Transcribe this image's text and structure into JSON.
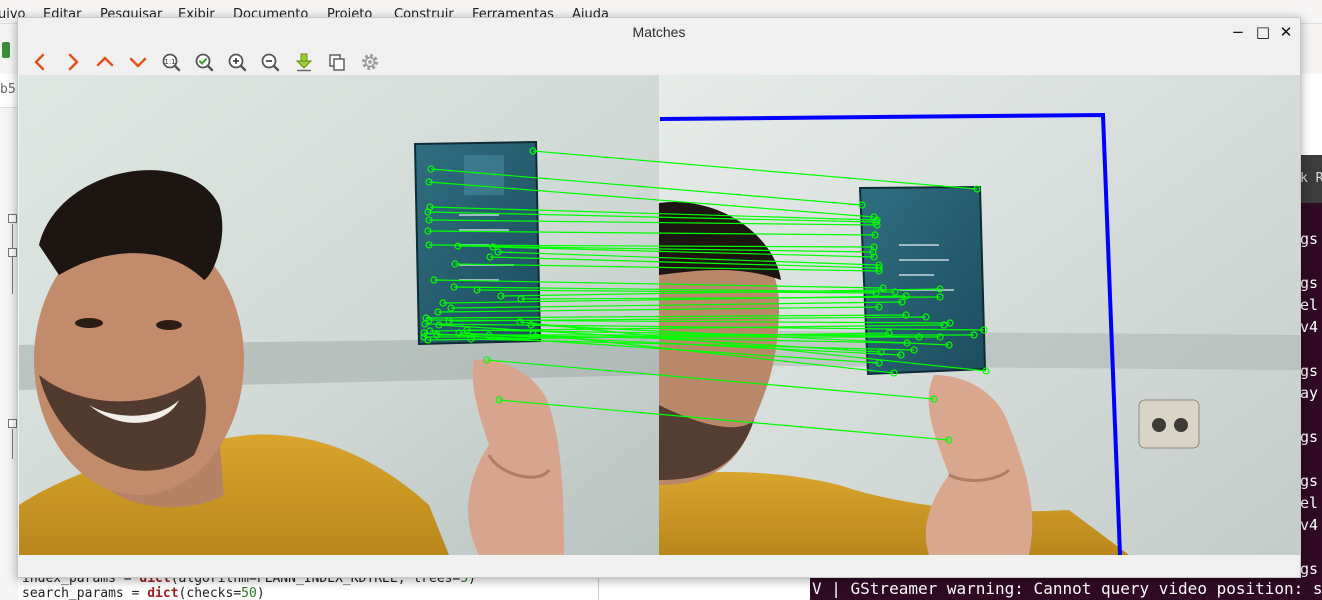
{
  "background_app": {
    "menu": [
      "uivo",
      "Editar",
      "Pesquisar",
      "Exibir",
      "Documento",
      "Projeto",
      "Construir",
      "Ferramentas",
      "Ajuda"
    ],
    "tab_fragment": "b5",
    "code_lines": [
      {
        "plain1": "index_params = ",
        "kw": "dict",
        "plain2": "(algorithm=FLANN_INDEX_KDTREE, trees=",
        "num": "5",
        "plain3": ")"
      },
      {
        "plain1": "search_params = ",
        "kw": "dict",
        "plain2": "(checks=",
        "num": "50",
        "plain3": ")"
      }
    ]
  },
  "terminal": {
    "tab_fragment": "k R",
    "lines": [
      "gs",
      "gs",
      "el",
      "v4",
      "gs",
      "ay",
      "gs",
      "gs",
      "el",
      "v4",
      "gs"
    ],
    "bottom_line": "V | GStreamer warning: Cannot query video position: s"
  },
  "window": {
    "title": "Matches",
    "buttons": {
      "minimize": "−",
      "maximize": "□",
      "close": "✕"
    },
    "toolbar": [
      {
        "name": "pan-left-button",
        "icon": "chevron-left-icon"
      },
      {
        "name": "pan-right-button",
        "icon": "chevron-right-icon"
      },
      {
        "name": "pan-up-button",
        "icon": "chevron-up-icon"
      },
      {
        "name": "pan-down-button",
        "icon": "chevron-down-icon"
      },
      {
        "name": "zoom-original-button",
        "icon": "zoom-1to1-icon"
      },
      {
        "name": "zoom-fit-button",
        "icon": "zoom-fit-check-icon"
      },
      {
        "name": "zoom-in-button",
        "icon": "zoom-in-icon"
      },
      {
        "name": "zoom-out-button",
        "icon": "zoom-out-icon"
      },
      {
        "name": "save-image-button",
        "icon": "download-icon"
      },
      {
        "name": "copy-image-button",
        "icon": "copy-icon"
      },
      {
        "name": "properties-button",
        "icon": "gear-icon"
      }
    ],
    "accent_colors": {
      "match_line": "#00ff00",
      "bbox": "#0000ff",
      "chevron": "#e2541c"
    }
  }
}
